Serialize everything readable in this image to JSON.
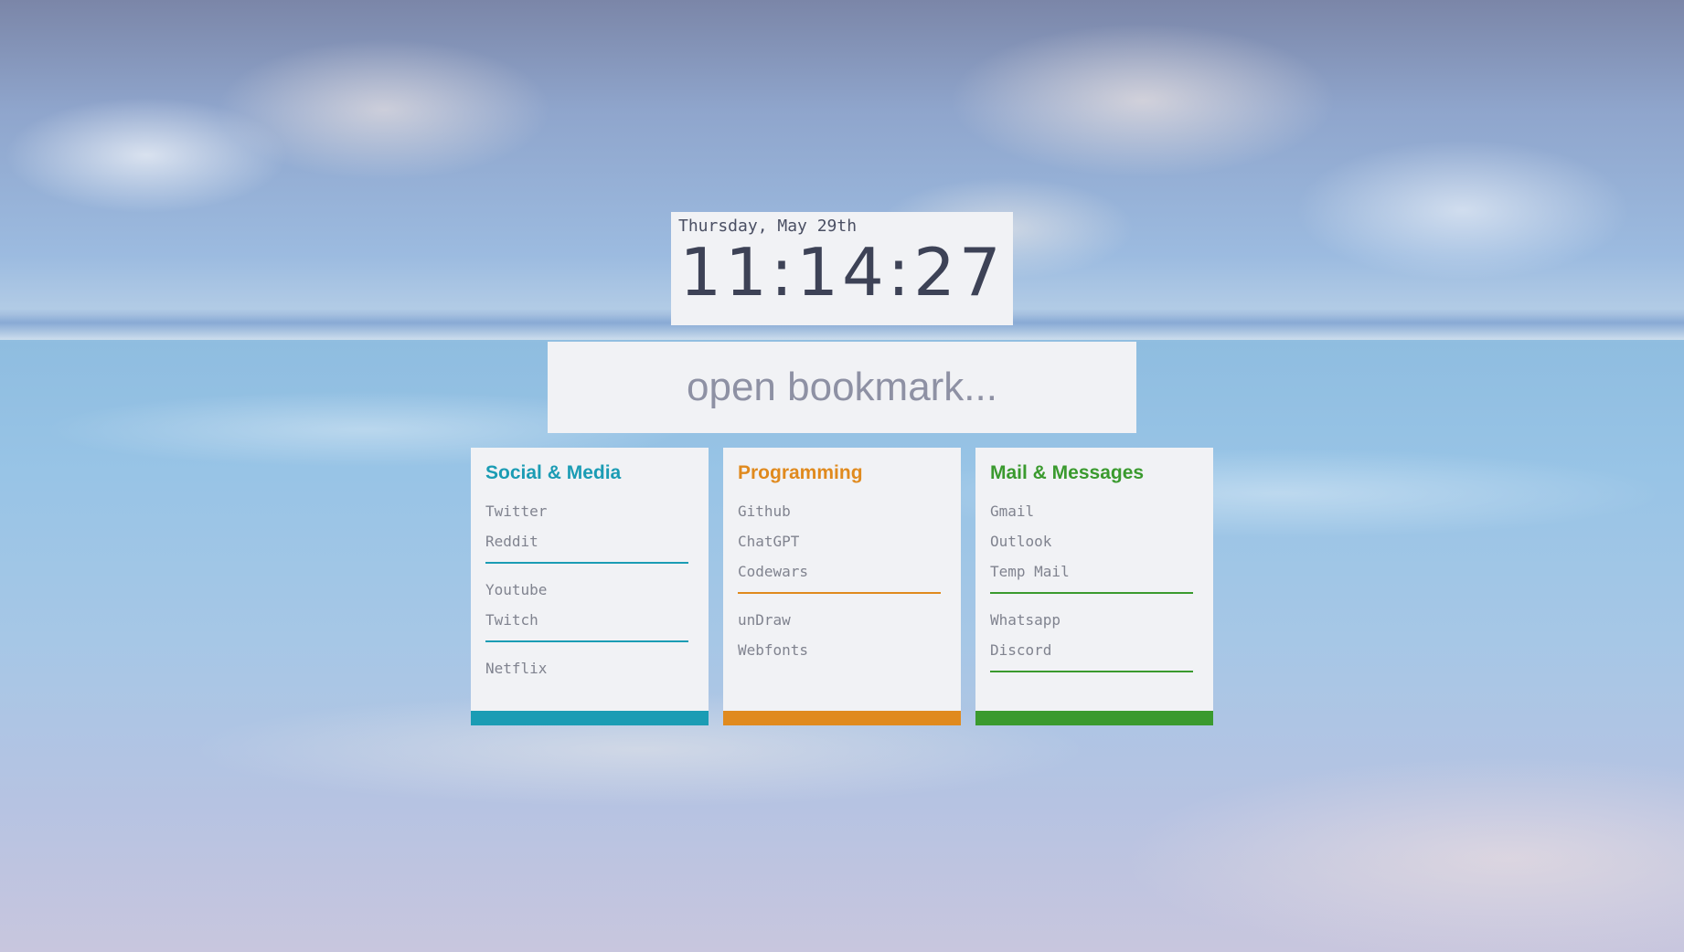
{
  "clock": {
    "date": "Thursday, May 29th",
    "time": "11:14:27"
  },
  "search": {
    "placeholder": "open bookmark..."
  },
  "cards": [
    {
      "title": "Social & Media",
      "accent": "#1b9cb4",
      "groups": [
        [
          "Twitter",
          "Reddit"
        ],
        [
          "Youtube",
          "Twitch"
        ],
        [
          "Netflix"
        ]
      ]
    },
    {
      "title": "Programming",
      "accent": "#e08a1e",
      "groups": [
        [
          "Github",
          "ChatGPT",
          "Codewars"
        ],
        [
          "unDraw",
          "Webfonts"
        ]
      ]
    },
    {
      "title": "Mail & Messages",
      "accent": "#3a9a2e",
      "groups": [
        [
          "Gmail",
          "Outlook",
          "Temp Mail"
        ],
        [
          "Whatsapp",
          "Discord"
        ]
      ]
    }
  ]
}
